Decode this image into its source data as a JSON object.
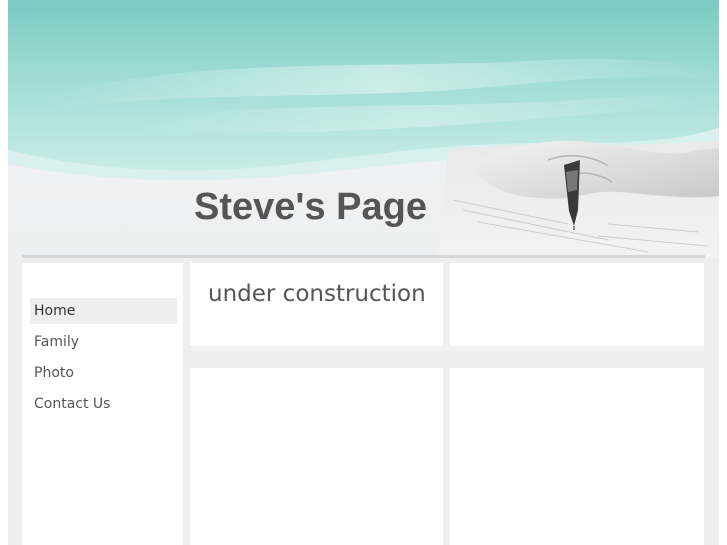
{
  "header": {
    "site_title": "Steve's Page",
    "banner_image": "hand-writing-with-pen-illustration",
    "colors": {
      "banner_teal": "#7fcdc6",
      "banner_light": "#cdeeea",
      "background": "#eeeeee",
      "text": "#555555"
    }
  },
  "nav": {
    "items": [
      {
        "label": "Home",
        "active": true
      },
      {
        "label": "Family",
        "active": false
      },
      {
        "label": "Photo",
        "active": false
      },
      {
        "label": "Contact Us",
        "active": false
      }
    ]
  },
  "main": {
    "heading": "under construction"
  }
}
